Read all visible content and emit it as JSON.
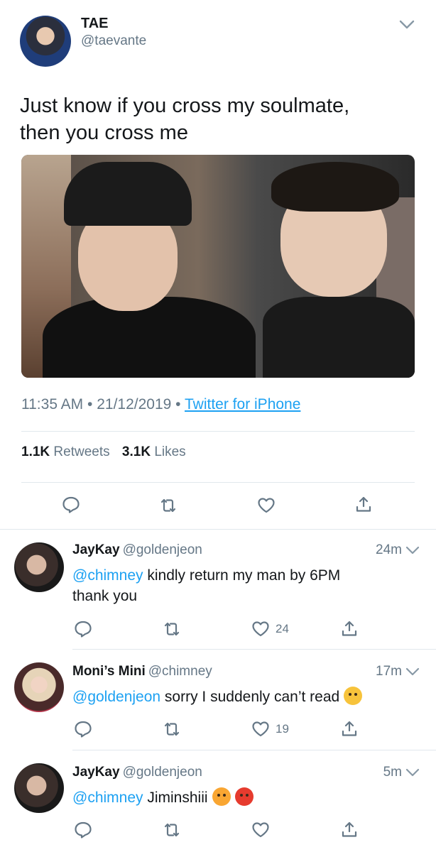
{
  "main_tweet": {
    "author_name": "TAE",
    "author_handle": "@taevante",
    "text_line1": "Just know if you cross my soulmate,",
    "text_line2": "then you cross me",
    "time": "11:35 AM",
    "separator": "•",
    "date": "21/12/2019",
    "source": "Twitter for iPhone",
    "retweets_count": "1.1K",
    "retweets_label": "Retweets",
    "likes_count": "3.1K",
    "likes_label": "Likes"
  },
  "replies": [
    {
      "name": "JayKay",
      "handle": "@goldenjeon",
      "time": "24m",
      "mention": "@chimney",
      "text": " kindly return my man by 6PM",
      "text_line2": "thank you",
      "likes": "24"
    },
    {
      "name": "Moni’s Mini",
      "handle": "@chimney",
      "time": "17m",
      "mention": "@goldenjeon",
      "text": " sorry I suddenly can’t read",
      "likes": "19"
    },
    {
      "name": "JayKay",
      "handle": "@goldenjeon",
      "time": "5m",
      "mention": "@chimney",
      "text": " Jiminshiii",
      "likes": ""
    }
  ],
  "colors": {
    "link": "#1da1f2",
    "muted": "#657786",
    "text": "#14171a",
    "divider": "#e1e8ed"
  },
  "icons": [
    "reply-icon",
    "retweet-icon",
    "like-icon",
    "share-icon",
    "chevron-down-icon"
  ]
}
